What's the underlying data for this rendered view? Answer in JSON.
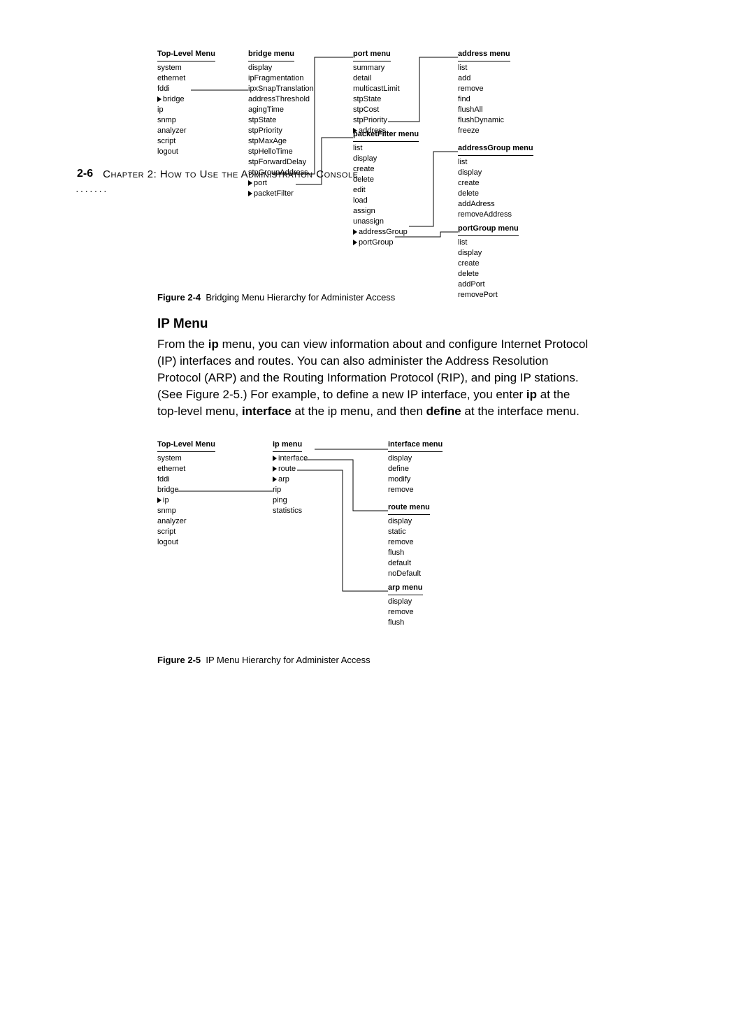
{
  "header": {
    "page": "2-6",
    "chapter": "Chapter 2: How to Use the Administration Console"
  },
  "fig1": {
    "caption_label": "Figure 2-4",
    "caption_text": "Bridging Menu Hierarchy for Administer Access",
    "top": {
      "title": "Top-Level Menu",
      "items": [
        "system",
        "ethernet",
        "fddi",
        "bridge",
        "ip",
        "snmp",
        "analyzer",
        "script",
        "logout"
      ]
    },
    "bridge": {
      "title": "bridge menu",
      "items": [
        "display",
        "ipFragmentation",
        "ipxSnapTranslation",
        "addressThreshold",
        "agingTime",
        "stpState",
        "stpPriority",
        "stpMaxAge",
        "stpHelloTime",
        "stpForwardDelay",
        "stpGroupAddress",
        "port",
        "packetFilter"
      ]
    },
    "port": {
      "title": "port menu",
      "items": [
        "summary",
        "detail",
        "multicastLimit",
        "stpState",
        "stpCost",
        "stpPriority",
        "address"
      ]
    },
    "address": {
      "title": "address menu",
      "items": [
        "list",
        "add",
        "remove",
        "find",
        "flushAll",
        "flushDynamic",
        "freeze"
      ]
    },
    "packetFilter": {
      "title": "packetFilter menu",
      "items": [
        "list",
        "display",
        "create",
        "delete",
        "edit",
        "load",
        "assign",
        "unassign",
        "addressGroup",
        "portGroup"
      ]
    },
    "addressGroup": {
      "title": "addressGroup menu",
      "items": [
        "list",
        "display",
        "create",
        "delete",
        "addAdress",
        "removeAddress"
      ]
    },
    "portGroup": {
      "title": "portGroup menu",
      "items": [
        "list",
        "display",
        "create",
        "delete",
        "addPort",
        "removePort"
      ]
    }
  },
  "section": {
    "heading": "IP Menu",
    "p1": "From the ",
    "p1b": "ip",
    "p1c": " menu, you can view information about and configure Internet Protocol (IP) interfaces and routes. You can also administer the Address Resolution Protocol (ARP) and the Routing Information Protocol (RIP), and ping IP stations. (See Figure 2-5.) For example, to define a new IP interface, you enter ",
    "p2b": "ip",
    "p2c": " at the top-level menu, ",
    "p3b": "interface",
    "p3c": " at the ip menu, and then ",
    "p4b": "define",
    "p4c": " at the interface menu."
  },
  "fig2": {
    "caption_label": "Figure 2-5",
    "caption_text": "IP Menu Hierarchy for Administer Access",
    "top": {
      "title": "Top-Level Menu",
      "items": [
        "system",
        "ethernet",
        "fddi",
        "bridge",
        "ip",
        "snmp",
        "analyzer",
        "script",
        "logout"
      ]
    },
    "ip": {
      "title": "ip menu",
      "items": [
        "interface",
        "route",
        "arp",
        "rip",
        "ping",
        "statistics"
      ]
    },
    "interface": {
      "title": "interface menu",
      "items": [
        "display",
        "define",
        "modify",
        "remove"
      ]
    },
    "route": {
      "title": "route menu",
      "items": [
        "display",
        "static",
        "remove",
        "flush",
        "default",
        "noDefault"
      ]
    },
    "arp": {
      "title": "arp menu",
      "items": [
        "display",
        "remove",
        "flush"
      ]
    }
  }
}
